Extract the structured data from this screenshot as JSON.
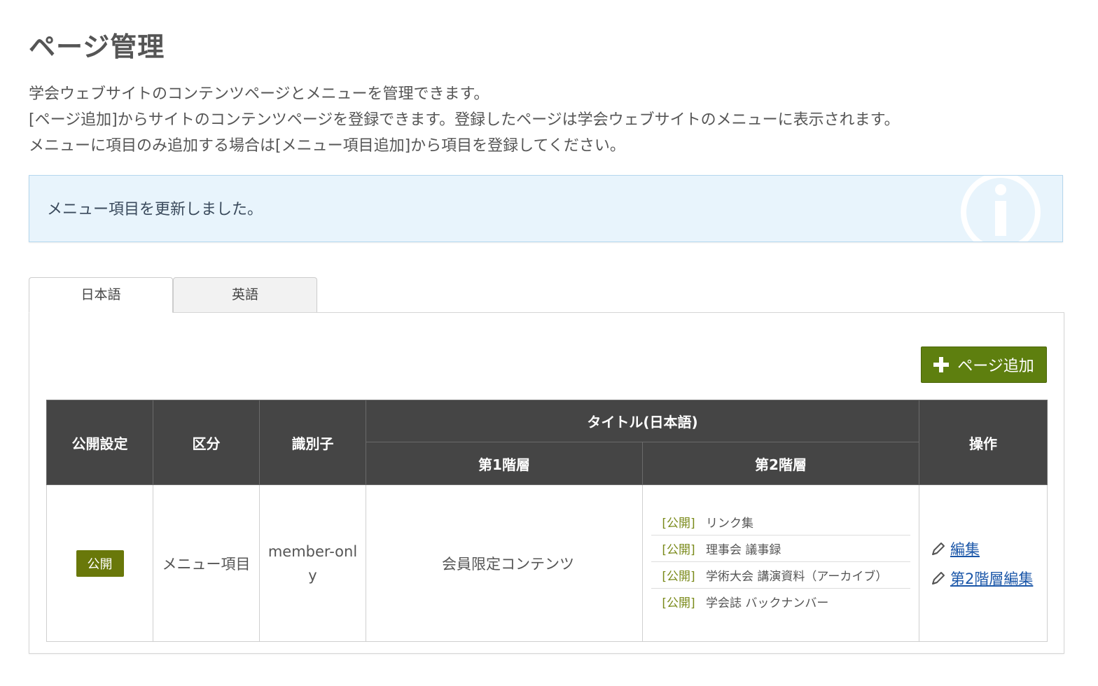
{
  "page": {
    "title": "ページ管理",
    "intro": [
      "学会ウェブサイトのコンテンツページとメニューを管理できます。",
      "[ページ追加]からサイトのコンテンツページを登録できます。登録したページは学会ウェブサイトのメニューに表示されます。",
      "メニューに項目のみ追加する場合は[メニュー項目追加]から項目を登録してください。"
    ]
  },
  "alert": {
    "message": "メニュー項目を更新しました。",
    "icon": "info-icon"
  },
  "tabs": [
    {
      "label": "日本語",
      "active": true
    },
    {
      "label": "英語",
      "active": false
    }
  ],
  "toolbar": {
    "add_page_label": "ページ追加"
  },
  "table": {
    "headers": {
      "status": "公開設定",
      "category": "区分",
      "identifier": "識別子",
      "title_group": "タイトル(日本語)",
      "level1": "第1階層",
      "level2": "第2階層",
      "actions": "操作"
    },
    "rows": [
      {
        "status": "公開",
        "category": "メニュー項目",
        "identifier": "member-only",
        "level1_title": "会員限定コンテンツ",
        "children": [
          {
            "status": "[公開]",
            "title": "リンク集"
          },
          {
            "status": "[公開]",
            "title": "理事会 議事録"
          },
          {
            "status": "[公開]",
            "title": "学術大会 講演資料（アーカイブ）"
          },
          {
            "status": "[公開]",
            "title": "学会誌 バックナンバー"
          }
        ],
        "edit_label": "編集",
        "edit_level2_label": "第2階層編集"
      }
    ]
  },
  "colors": {
    "header_bg": "#454545",
    "add_button": "#5e7f0f",
    "badge": "#69780a",
    "alert_bg": "#e8f4fc",
    "link": "#1a56a8"
  }
}
